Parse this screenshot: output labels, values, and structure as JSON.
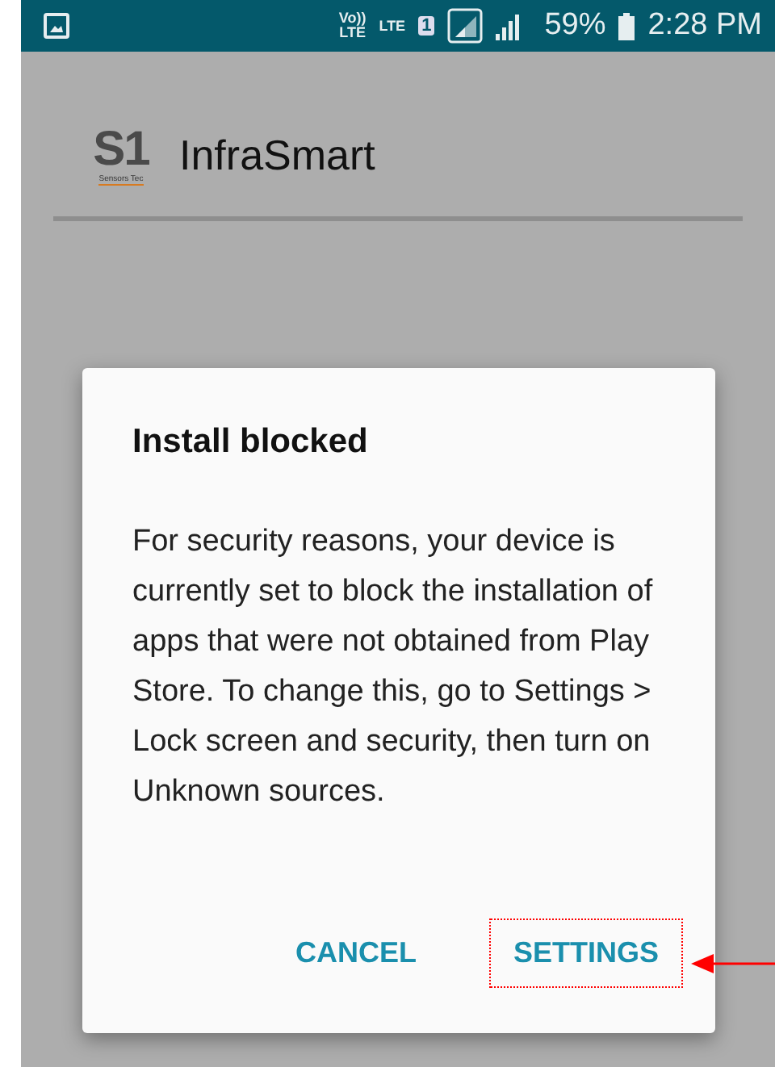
{
  "status_bar": {
    "volte": "Vo))",
    "volte_sub": "LTE",
    "network": "LTE",
    "sim": "1",
    "battery": "59%",
    "time": "2:28 PM"
  },
  "app_bar": {
    "logo_mark": "S1",
    "logo_caption": "Sensors Tec",
    "title": "InfraSmart"
  },
  "dialog": {
    "title": "Install blocked",
    "message": "For security reasons, your device is currently set to block the installation of apps that were not obtained from Play Store. To change this, go to Settings > Lock screen and security, then turn on Unknown sources.",
    "buttons": [
      {
        "label": "CANCEL",
        "highlighted": false
      },
      {
        "label": "SETTINGS",
        "highlighted": true
      }
    ]
  }
}
